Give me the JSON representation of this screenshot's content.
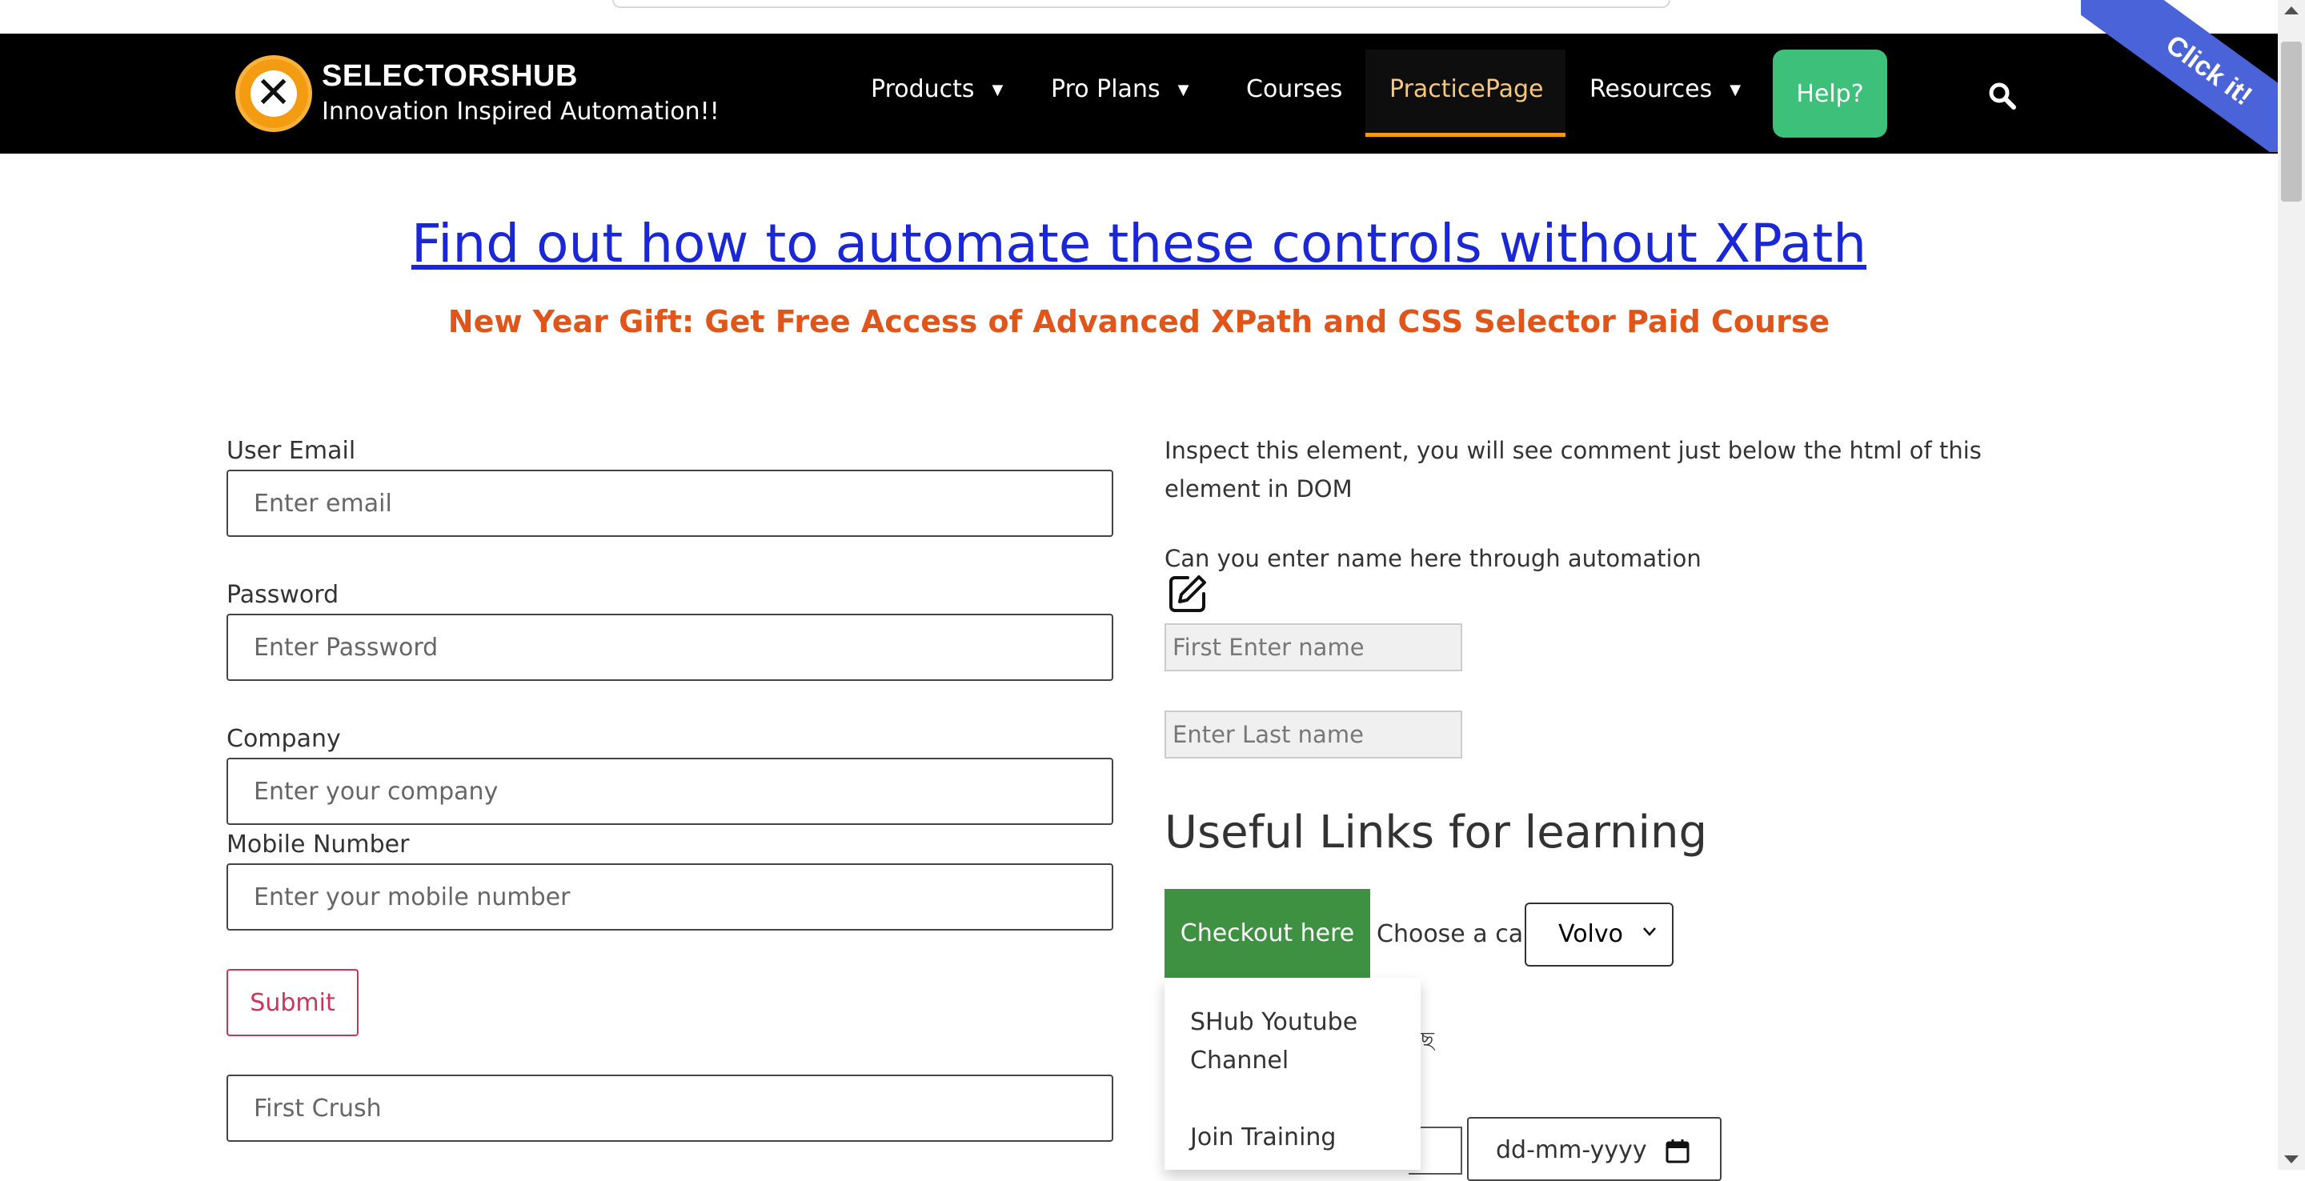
{
  "header": {
    "brand_name": "SELECTORSHUB",
    "brand_tagline": "Innovation Inspired Automation!!",
    "logo_icon": "selectorshub-x-logo",
    "nav": [
      {
        "label": "Products",
        "dropdown": true
      },
      {
        "label": "Pro Plans",
        "dropdown": true
      },
      {
        "label": "Courses",
        "dropdown": false
      },
      {
        "label": "PracticePage",
        "dropdown": false,
        "active": true
      },
      {
        "label": "Resources",
        "dropdown": true
      }
    ],
    "help_label": "Help?",
    "search_icon": "search-icon",
    "ribbon_label": "Click it!",
    "colors": {
      "navbar_bg": "#000000",
      "active_underline": "#f39c12",
      "help_bg": "#3cc07a",
      "ribbon_bg": "#4b63d9"
    }
  },
  "main": {
    "headline_link": "Find out how to automate these controls without XPath",
    "gift_text": "New Year Gift: Get Free Access of Advanced XPath and CSS Selector Paid Course",
    "colors": {
      "headline": "#1a27d6",
      "gift": "#e0561a"
    }
  },
  "form": {
    "email_label": "User Email",
    "email_placeholder": "Enter email",
    "password_label": "Password",
    "password_placeholder": "Enter Password",
    "company_label": "Company",
    "company_placeholder": "Enter your company",
    "mobile_label": "Mobile Number",
    "mobile_placeholder": "Enter your mobile number",
    "submit_label": "Submit",
    "first_crush_placeholder": "First Crush"
  },
  "right": {
    "inspect_text": "Inspect this element, you will see comment just below the html of this element in DOM",
    "automation_text": "Can you enter name here through automation",
    "edit_icon": "edit-icon",
    "first_name_placeholder": "First Enter name",
    "last_name_placeholder": "Enter Last name",
    "useful_heading": "Useful Links for learning",
    "checkout_label": "Checkout here",
    "choose_car_label": "Choose a car:",
    "car_selected": "Volvo",
    "dropdown_items": [
      "SHub Youtube Channel",
      "Join Training"
    ],
    "partial_glyph": "ছ",
    "date_placeholder": "dd-mm-yyyy",
    "calendar_icon": "calendar-icon"
  }
}
